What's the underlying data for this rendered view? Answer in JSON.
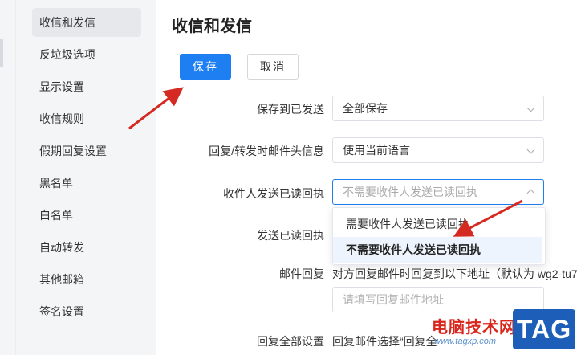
{
  "sidebar": {
    "items": [
      {
        "label": "收信和发信",
        "active": true
      },
      {
        "label": "反垃圾选项"
      },
      {
        "label": "显示设置"
      },
      {
        "label": "收信规则"
      },
      {
        "label": "假期回复设置"
      },
      {
        "label": "黑名单"
      },
      {
        "label": "白名单"
      },
      {
        "label": "自动转发"
      },
      {
        "label": "其他邮箱"
      },
      {
        "label": "签名设置"
      }
    ]
  },
  "main": {
    "title": "收信和发信",
    "save_label": "保存",
    "cancel_label": "取消",
    "rows": {
      "save_sent": {
        "label": "保存到已发送",
        "value": "全部保存"
      },
      "reply_header": {
        "label": "回复/转发时邮件头信息",
        "value": "使用当前语言"
      },
      "read_receipt_request": {
        "label": "收件人发送已读回执",
        "value": "不需要收件人发送已读回执"
      },
      "send_receipt": {
        "label": "发送已读回执"
      },
      "reply_to": {
        "label": "邮件回复",
        "text": "对方回复邮件时回复到以下地址（默认为 wg2-tu7",
        "placeholder": "请填写回复邮件地址"
      },
      "reply_all": {
        "label": "回复全部设置",
        "text": "回复邮件选择“回复全"
      }
    },
    "dropdown": {
      "options": [
        "需要收件人发送已读回执",
        "不需要收件人发送已读回执"
      ],
      "selected_index": 1
    }
  },
  "watermark": {
    "text": "电脑技术网",
    "url": "www.tagxp.com",
    "badge": "TAG"
  },
  "colors": {
    "accent": "#1e7ff2",
    "sidebar_bg": "#f4f5f7",
    "arrow": "#d42a21",
    "watermark_red": "#d8261c",
    "watermark_blue": "#1d5fb8"
  }
}
